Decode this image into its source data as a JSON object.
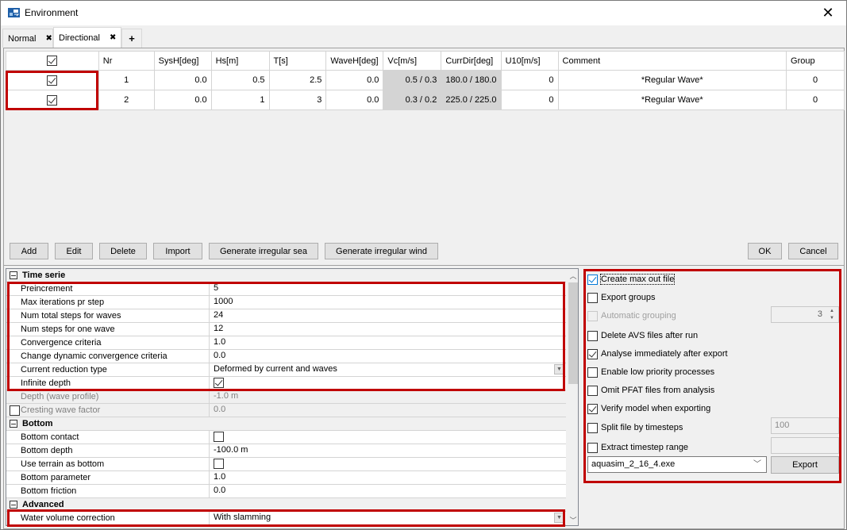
{
  "window": {
    "title": "Environment",
    "close_icon": "close-icon",
    "app_icon": "environment-app-icon"
  },
  "tabs": [
    {
      "label": "Normal",
      "active": false,
      "close": "✖"
    },
    {
      "label": "Directional",
      "active": true,
      "close": "✖"
    },
    {
      "label": "+",
      "active": false
    }
  ],
  "grid": {
    "columns": [
      "",
      "Nr",
      "SysH[deg]",
      "Hs[m]",
      "T[s]",
      "WaveH[deg]",
      "Vc[m/s]",
      "CurrDir[deg]",
      "U10[m/s]",
      "Comment",
      "Group"
    ],
    "header_checked": true,
    "rows": [
      {
        "checked": true,
        "nr": "1",
        "sysh": "0.0",
        "hs": "0.5",
        "t": "2.5",
        "waveh": "0.0",
        "vc": "0.5 / 0.3",
        "currdir": "180.0 / 180.0",
        "u10": "0",
        "comment": "*Regular Wave*",
        "group": "0"
      },
      {
        "checked": true,
        "nr": "2",
        "sysh": "0.0",
        "hs": "1",
        "t": "3",
        "waveh": "0.0",
        "vc": "0.3 / 0.2",
        "currdir": "225.0 / 225.0",
        "u10": "0",
        "comment": "*Regular Wave*",
        "group": "0"
      }
    ]
  },
  "buttons": {
    "add": "Add",
    "edit": "Edit",
    "delete": "Delete",
    "import": "Import",
    "gen_sea": "Generate irregular sea",
    "gen_wind": "Generate irregular wind",
    "ok": "OK",
    "cancel": "Cancel"
  },
  "properties": {
    "time_serie": {
      "label": "Time serie",
      "preincrement": {
        "label": "Preincrement",
        "value": "5"
      },
      "max_iter": {
        "label": "Max iterations pr step",
        "value": "1000"
      },
      "num_total_steps": {
        "label": "Num total steps for waves",
        "value": "24"
      },
      "num_steps_one": {
        "label": "Num steps for one wave",
        "value": "12"
      },
      "conv_criteria": {
        "label": "Convergence criteria",
        "value": "1.0"
      },
      "change_dyn_conv": {
        "label": "Change dynamic convergence criteria",
        "value": "0.0"
      },
      "current_reduction": {
        "label": "Current reduction type",
        "value": "Deformed by current and waves"
      },
      "infinite_depth": {
        "label": "Infinite depth",
        "checked": true
      },
      "depth_wave_profile": {
        "label": "Depth (wave profile)",
        "value": "-1.0 m"
      },
      "cresting_wave": {
        "label": "Cresting wave factor",
        "value": "0.0",
        "checked": false
      }
    },
    "bottom": {
      "label": "Bottom",
      "bottom_contact": {
        "label": "Bottom contact",
        "checked": false
      },
      "bottom_depth": {
        "label": "Bottom depth",
        "value": "-100.0 m"
      },
      "use_terrain": {
        "label": "Use terrain as bottom",
        "checked": false
      },
      "bottom_param": {
        "label": "Bottom parameter",
        "value": "1.0"
      },
      "bottom_friction": {
        "label": "Bottom friction",
        "value": "0.0"
      }
    },
    "advanced": {
      "label": "Advanced",
      "water_volume": {
        "label": "Water volume correction",
        "value": "With slamming"
      }
    }
  },
  "options": {
    "create_max_out": {
      "label": "Create max out file",
      "checked": true
    },
    "export_groups": {
      "label": "Export groups",
      "checked": false
    },
    "auto_grouping": {
      "label": "Automatic grouping",
      "checked": false,
      "disabled": true,
      "value": "3"
    },
    "delete_avs": {
      "label": "Delete AVS files after run",
      "checked": false
    },
    "analyse_immediately": {
      "label": "Analyse immediately after export",
      "checked": true
    },
    "low_priority": {
      "label": "Enable low priority processes",
      "checked": false
    },
    "omit_pfat": {
      "label": "Omit PFAT files from analysis",
      "checked": false
    },
    "verify_model": {
      "label": "Verify model when exporting",
      "checked": true
    },
    "split_file": {
      "label": "Split file by timesteps",
      "checked": false,
      "value": "100"
    },
    "extract_range": {
      "label": "Extract timestep range",
      "checked": false,
      "value": ""
    },
    "executable": "aquasim_2_16_4.exe",
    "export_label": "Export"
  },
  "colors": {
    "highlight": "#c00000",
    "focus_blue": "#0078d7"
  }
}
